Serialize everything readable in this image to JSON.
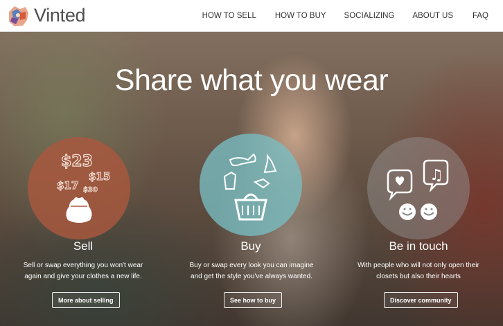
{
  "header": {
    "logo_text": "Vinted",
    "nav": [
      "HOW TO SELL",
      "HOW TO BUY",
      "SOCIALIZING",
      "ABOUT US",
      "FAQ"
    ]
  },
  "hero": {
    "headline": "Share what you wear"
  },
  "columns": {
    "sell": {
      "title": "Sell",
      "desc_line1": "Sell or swap everything you won't wear",
      "desc_line2": "again and give your clothes a new life.",
      "button": "More about selling",
      "prices": [
        "$23",
        "$15",
        "$17",
        "$30"
      ]
    },
    "buy": {
      "title": "Buy",
      "desc_line1": "Buy or swap every look you can imagine",
      "desc_line2": "and get the style you've always wanted.",
      "button": "See how to buy"
    },
    "touch": {
      "title": "Be in touch",
      "desc_line1": "With people who will not only open their",
      "desc_line2": "closets but also their hearts",
      "button": "Discover community"
    }
  },
  "colors": {
    "sell_circle": "#aa583e",
    "buy_circle": "#78bec3",
    "touch_circle": "#969696"
  }
}
